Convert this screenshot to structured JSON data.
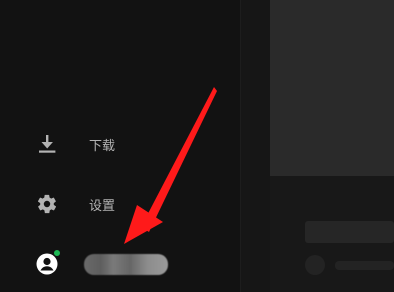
{
  "sidebar": {
    "items": [
      {
        "label": "下载",
        "icon": "download-icon"
      },
      {
        "label": "设置",
        "icon": "gear-icon"
      }
    ],
    "profile": {
      "icon": "user-avatar-icon",
      "status_color": "#1db954",
      "username_redacted": true
    }
  },
  "annotation": {
    "type": "arrow",
    "color": "#ff1a1a"
  }
}
